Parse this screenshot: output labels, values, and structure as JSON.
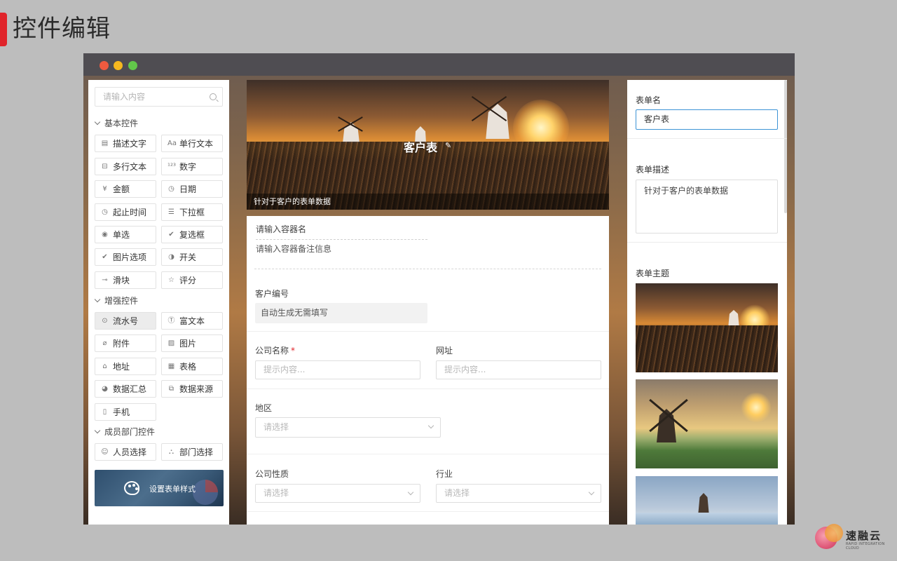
{
  "slide": {
    "title": "控件编辑"
  },
  "left": {
    "search_placeholder": "请输入内容",
    "groups": {
      "basic": "基本控件",
      "enhanced": "增强控件",
      "member": "成员部门控件"
    },
    "basic_items": [
      "描述文字",
      "单行文本",
      "多行文本",
      "数字",
      "金额",
      "日期",
      "起止时间",
      "下拉框",
      "单选",
      "复选框",
      "图片选项",
      "开关",
      "滑块",
      "评分"
    ],
    "enhanced_items": [
      "流水号",
      "富文本",
      "附件",
      "图片",
      "地址",
      "表格",
      "数据汇总",
      "数据来源",
      "手机"
    ],
    "member_items": [
      "人员选择",
      "部门选择"
    ],
    "style_button": "设置表单样式"
  },
  "banner": {
    "title": "客户表",
    "description": "针对于客户的表单数据"
  },
  "form": {
    "container_name": "请输入容器名",
    "container_note": "请输入容器备注信息",
    "customer_no_label": "客户编号",
    "customer_no_value": "自动生成无需填写",
    "company_label": "公司名称",
    "required_mark": "*",
    "company_placeholder": "提示内容...",
    "website_label": "网址",
    "website_placeholder": "提示内容...",
    "region_label": "地区",
    "region_placeholder": "请选择",
    "nature_label": "公司性质",
    "nature_placeholder": "请选择",
    "industry_label": "行业",
    "industry_placeholder": "请选择"
  },
  "right": {
    "form_name_label": "表单名",
    "form_name_value": "客户表",
    "form_desc_label": "表单描述",
    "form_desc_value": "针对于客户的表单数据",
    "theme_label": "表单主题"
  },
  "brand": {
    "name": "速融云",
    "sub": "RAPID INTEGRATION CLOUD"
  },
  "colors": {
    "accent": "#e0242a",
    "focus": "#3d94d6",
    "titlebar": "#4f4d52"
  }
}
